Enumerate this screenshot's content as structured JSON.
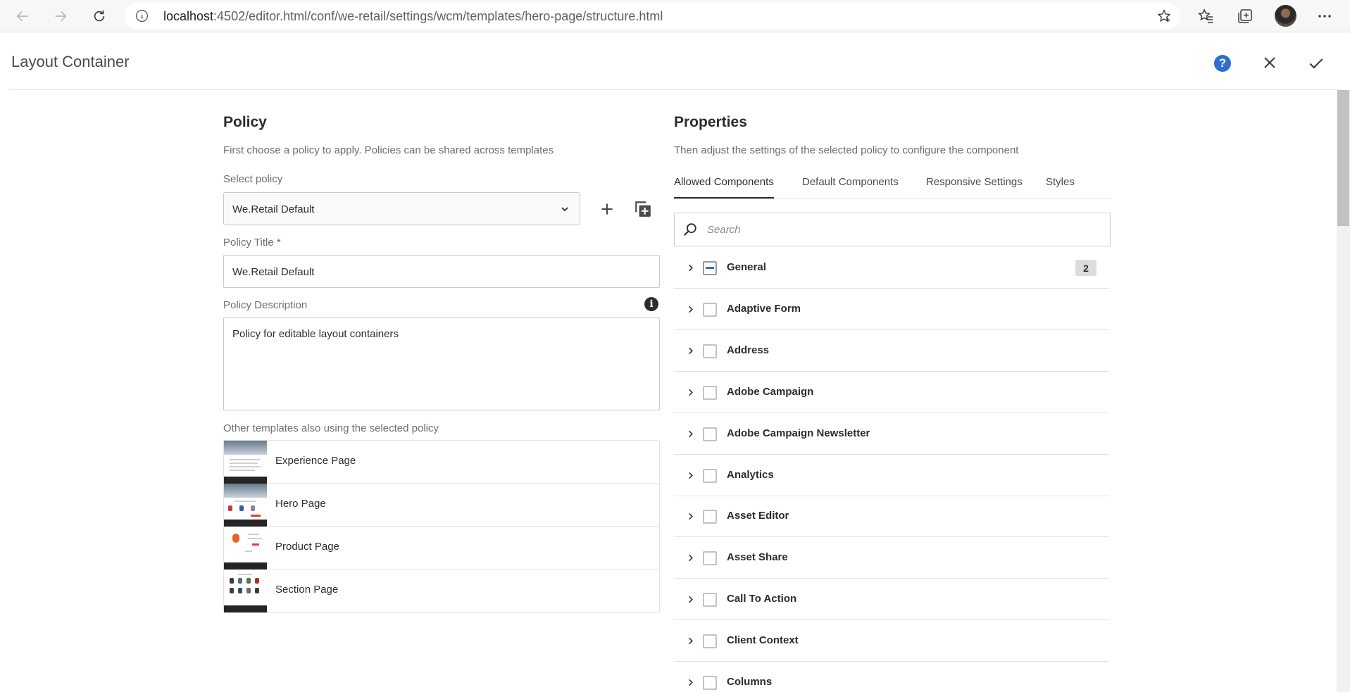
{
  "browser": {
    "url_host": "localhost",
    "url_rest": ":4502/editor.html/conf/we-retail/settings/wcm/templates/hero-page/structure.html"
  },
  "dialog": {
    "title": "Layout Container",
    "help_label": "?"
  },
  "policy": {
    "heading": "Policy",
    "subheading": "First choose a policy to apply. Policies can be shared across templates",
    "select_label": "Select policy",
    "selected_policy": "We.Retail Default",
    "title_label": "Policy Title *",
    "title_value": "We.Retail Default",
    "description_label": "Policy Description",
    "description_value": "Policy for editable layout containers",
    "others_label": "Other templates also using the selected policy",
    "templates": [
      {
        "name": "Experience Page"
      },
      {
        "name": "Hero Page"
      },
      {
        "name": "Product Page"
      },
      {
        "name": "Section Page"
      }
    ]
  },
  "properties": {
    "heading": "Properties",
    "subheading": "Then adjust the settings of the selected policy to configure the component",
    "tabs": [
      {
        "label": "Allowed Components",
        "active": true
      },
      {
        "label": "Default Components",
        "active": false
      },
      {
        "label": "Responsive Settings",
        "active": false
      },
      {
        "label": "Styles",
        "active": false
      }
    ],
    "search_placeholder": "Search",
    "components": [
      {
        "name": "General",
        "state": "indeterminate",
        "count": "2"
      },
      {
        "name": "Adaptive Form",
        "state": "unchecked"
      },
      {
        "name": "Address",
        "state": "unchecked"
      },
      {
        "name": "Adobe Campaign",
        "state": "unchecked"
      },
      {
        "name": "Adobe Campaign Newsletter",
        "state": "unchecked"
      },
      {
        "name": "Analytics",
        "state": "unchecked"
      },
      {
        "name": "Asset Editor",
        "state": "unchecked"
      },
      {
        "name": "Asset Share",
        "state": "unchecked"
      },
      {
        "name": "Call To Action",
        "state": "unchecked"
      },
      {
        "name": "Client Context",
        "state": "unchecked"
      },
      {
        "name": "Columns",
        "state": "unchecked"
      }
    ]
  },
  "colors": {
    "accent": "#2e6fcf",
    "text": "#2c2c2c"
  }
}
